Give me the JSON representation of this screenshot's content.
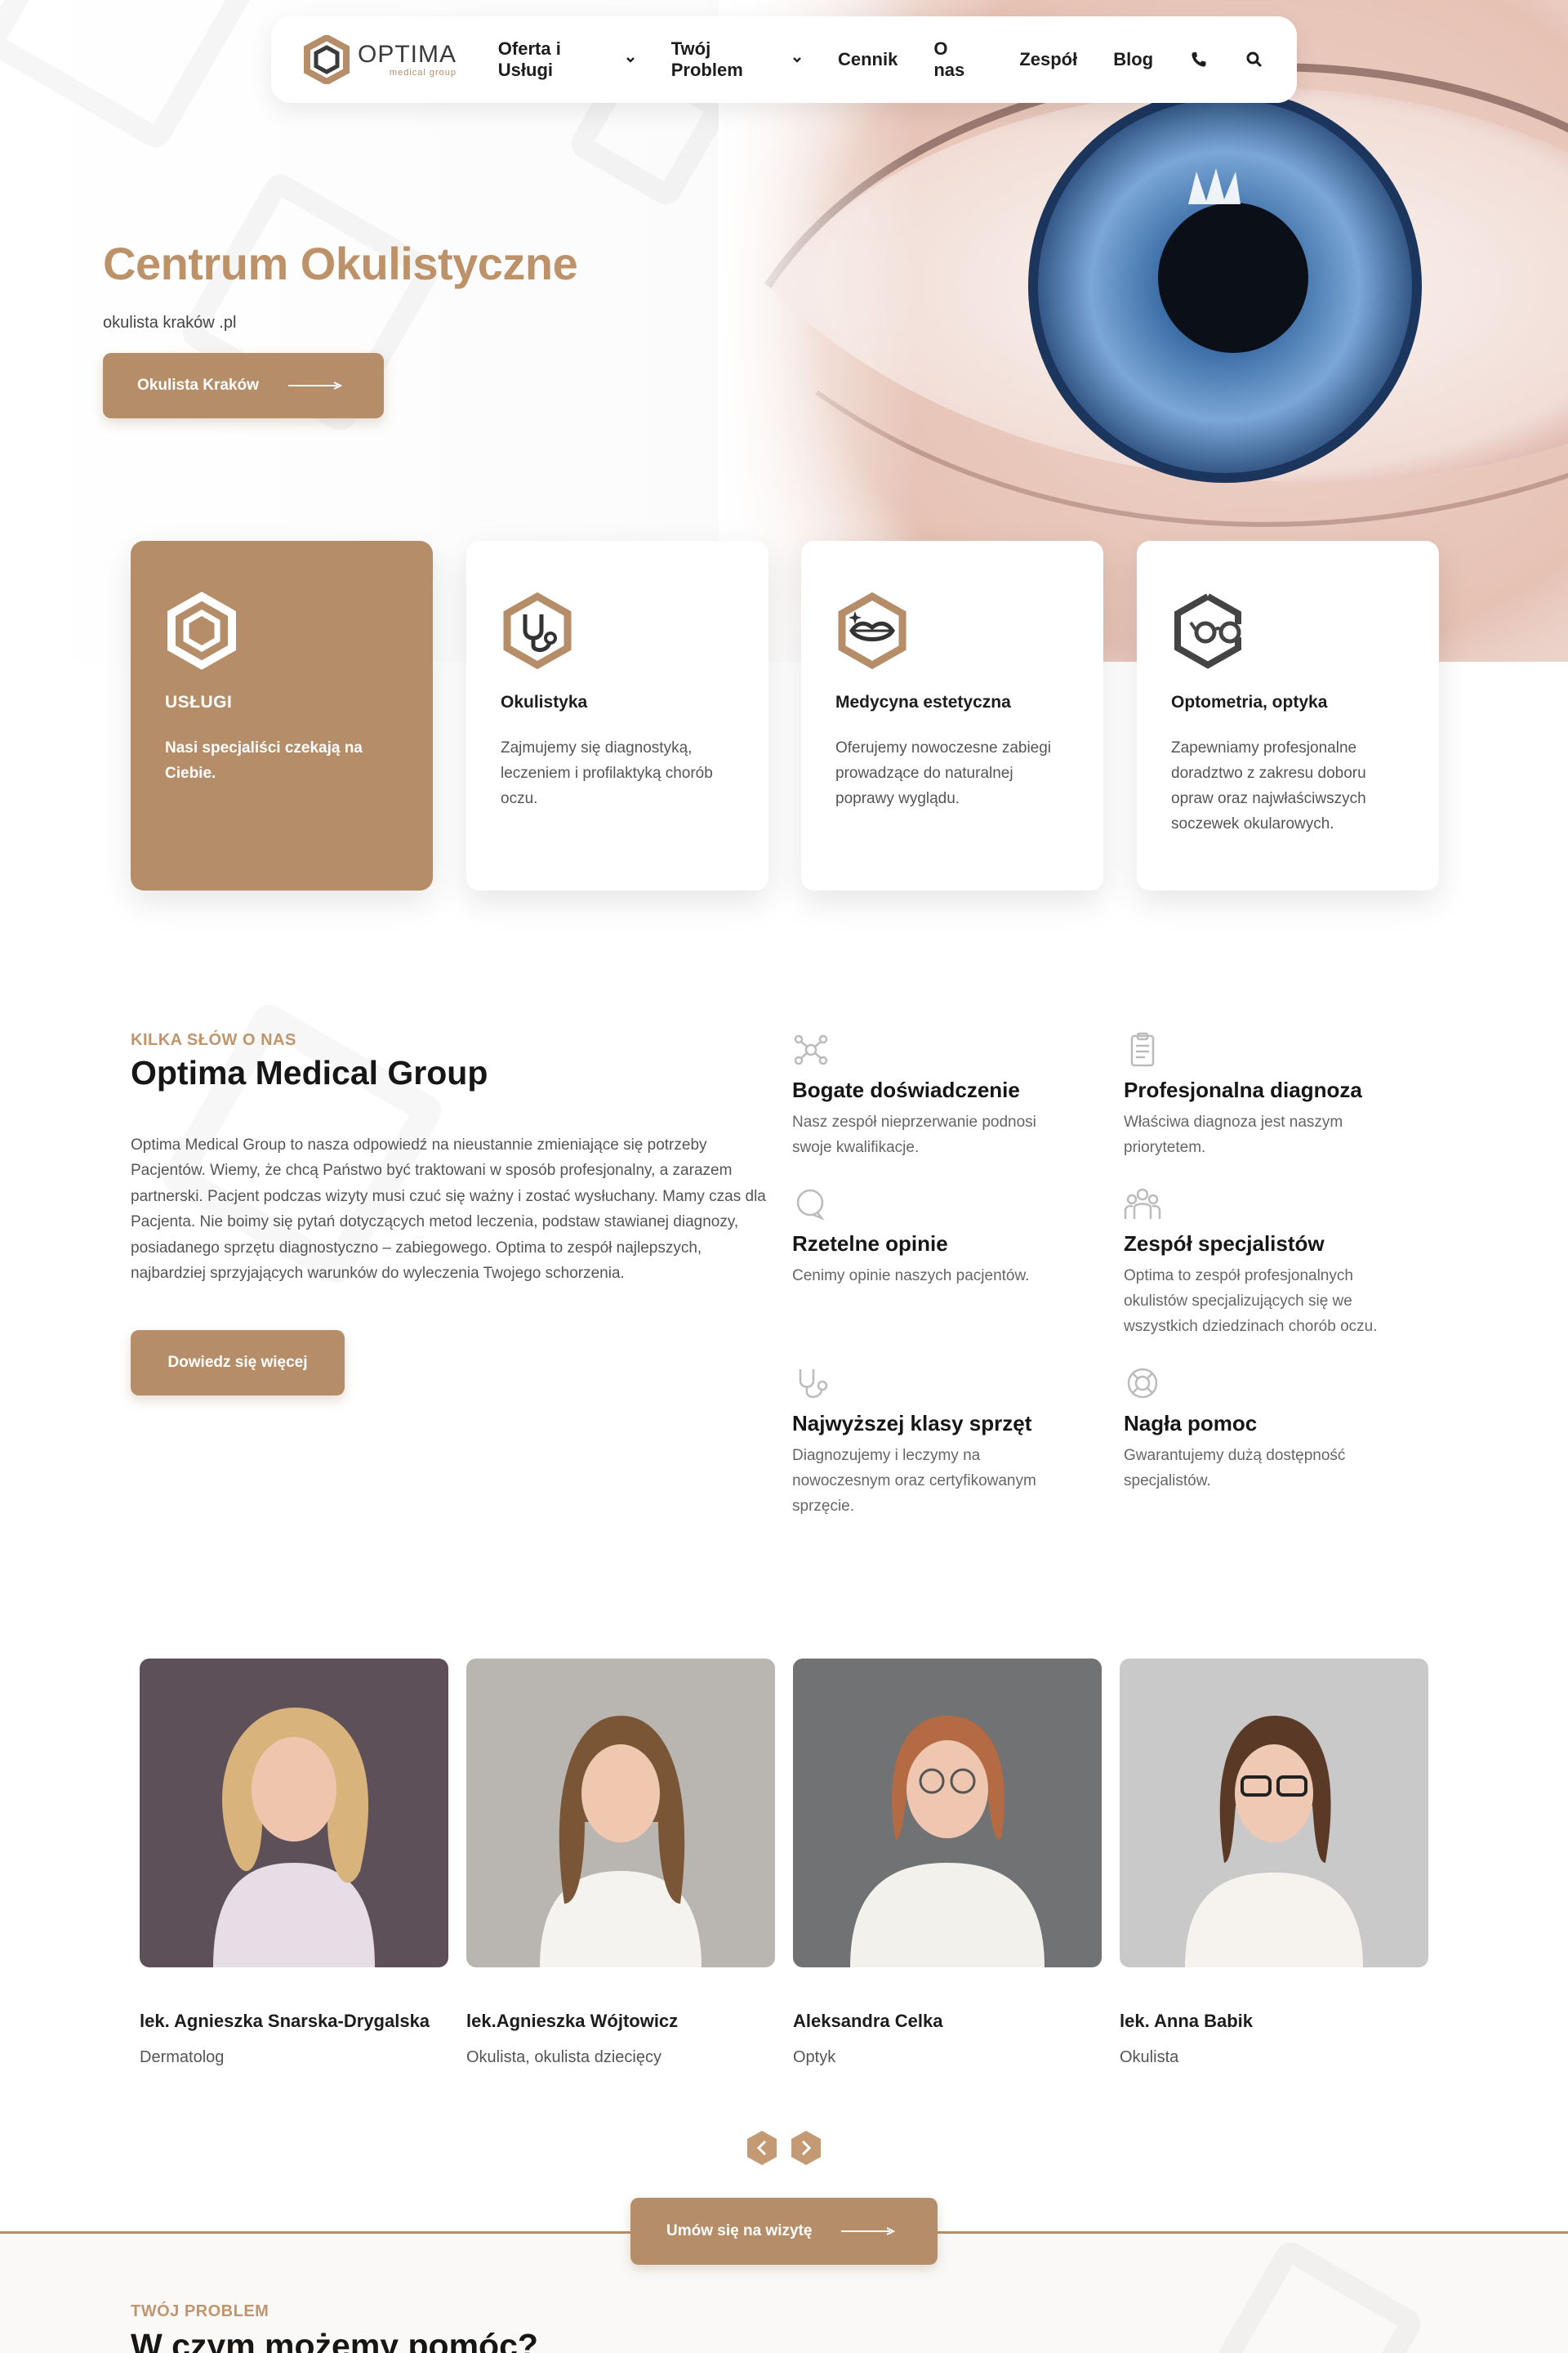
{
  "colors": {
    "accent": "#b58e69",
    "title_accent": "#be9269",
    "text": "#161616"
  },
  "nav": {
    "logo_name": "OPTIMA",
    "logo_sub": "medical group",
    "items": [
      {
        "label": "Oferta i Usługi",
        "dropdown": true
      },
      {
        "label": "Twój Problem",
        "dropdown": true
      },
      {
        "label": "Cennik",
        "dropdown": false
      },
      {
        "label": "O nas",
        "dropdown": false
      },
      {
        "label": "Zespół",
        "dropdown": false
      },
      {
        "label": "Blog",
        "dropdown": false
      }
    ],
    "icons": [
      "phone-icon",
      "search-icon"
    ]
  },
  "hero": {
    "title": "Centrum Okulistyczne",
    "subtitle": "okulista kraków .pl",
    "button_label": "Okulista Kraków"
  },
  "services": [
    {
      "title": "USŁUGI",
      "text": "Nasi specjaliści czekają na Ciebie.",
      "icon": "hexagon-logo-icon"
    },
    {
      "title": "Okulistyka",
      "text": "Zajmujemy się diagnostyką, leczeniem i profilaktyką chorób oczu.",
      "icon": "stethoscope-icon"
    },
    {
      "title": "Medycyna estetyczna",
      "text": "Oferujemy nowoczesne zabiegi prowadzące do naturalnej poprawy wyglądu.",
      "icon": "lips-icon"
    },
    {
      "title": "Optometria, optyka",
      "text": "Zapewniamy profesjonalne doradztwo z zakresu doboru opraw oraz najwłaściwszych soczewek okularowych.",
      "icon": "glasses-icon"
    }
  ],
  "about": {
    "eyebrow": "KILKA SŁÓW O NAS",
    "title": "Optima Medical Group",
    "text": "Optima Medical Group to nasza odpowiedź na nieustannie zmieniające się potrzeby Pacjentów. Wiemy, że chcą Państwo być traktowani w sposób profesjonalny, a zarazem partnerski. Pacjent podczas wizyty musi czuć się ważny i zostać wysłuchany. Mamy czas dla Pacjenta. Nie boimy się pytań dotyczących metod leczenia, podstaw stawianej diagnozy, posiadanego sprzętu diagnostyczno – zabiegowego. Optima to zespół najlepszych, najbardziej sprzyjających warunków do wyleczenia Twojego schorzenia.",
    "button_label": "Dowiedz się więcej",
    "features": [
      {
        "title": "Bogate doświadczenie",
        "text": "Nasz zespół nieprzerwanie podnosi swoje kwalifikacje.",
        "icon": "molecule-icon"
      },
      {
        "title": "Profesjonalna diagnoza",
        "text": "Właściwa diagnoza jest naszym priorytetem.",
        "icon": "clipboard-icon"
      },
      {
        "title": "Rzetelne opinie",
        "text": "Cenimy opinie naszych pacjentów.",
        "icon": "chat-bubble-icon"
      },
      {
        "title": "Zespół specjalistów",
        "text": "Optima to zespół profesjonalnych okulistów specjalizujących się we wszystkich dziedzinach chorób oczu.",
        "icon": "team-icon"
      },
      {
        "title": "Najwyższej klasy sprzęt",
        "text": "Diagnozujemy i leczymy na nowoczesnym oraz certyfikowanym sprzęcie.",
        "icon": "stethoscope-small-icon"
      },
      {
        "title": "Nagła pomoc",
        "text": "Gwarantujemy dużą dostępność specjalistów.",
        "icon": "lifebuoy-icon"
      }
    ]
  },
  "team": [
    {
      "name": "lek. Agnieszka Snarska-Drygalska",
      "role": "Dermatolog"
    },
    {
      "name": "lek.Agnieszka Wójtowicz",
      "role": "Okulista, okulista dziecięcy"
    },
    {
      "name": "Aleksandra Celka",
      "role": "Optyk"
    },
    {
      "name": "lek. Anna Babik",
      "role": "Okulista"
    }
  ],
  "cta": {
    "visit_label": "Umów się na wizytę"
  },
  "problem": {
    "eyebrow": "TWÓJ PROBLEM",
    "title": "W czym możemy pomóc?"
  }
}
